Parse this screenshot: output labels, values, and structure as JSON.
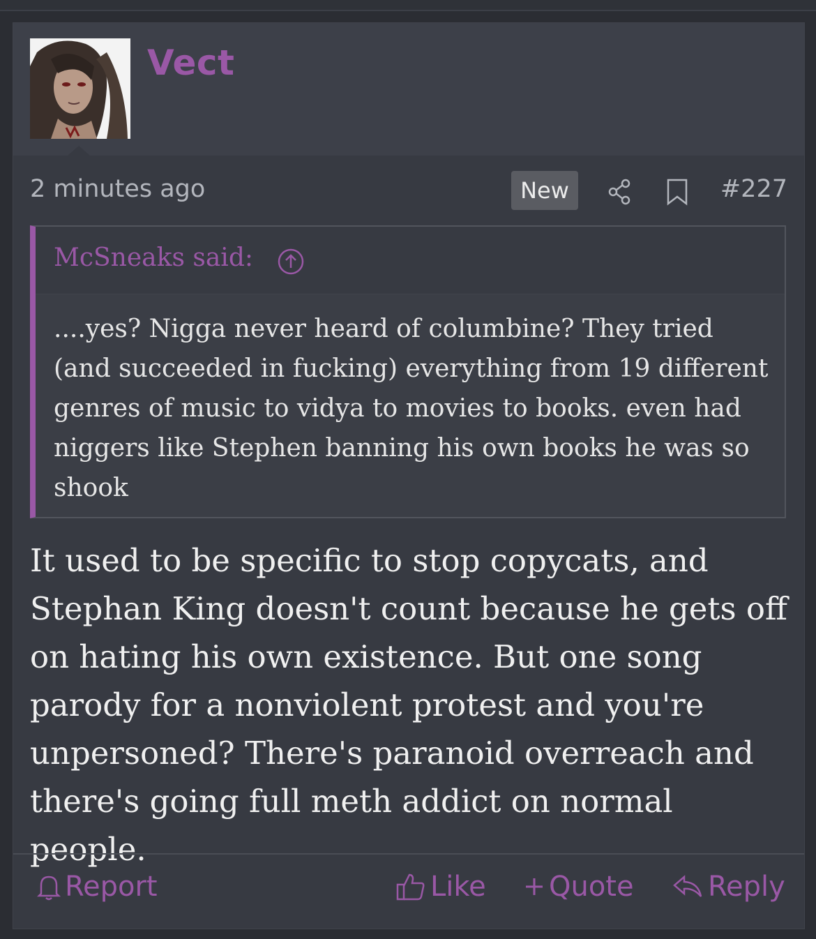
{
  "post": {
    "username": "Vect",
    "timestamp": "2 minutes ago",
    "new_badge": "New",
    "post_number": "#227",
    "quote": {
      "author": "McSneaks said:",
      "text": "....yes? Nigga never heard of columbine? They tried (and succeeded in fucking) everything from 19 different genres of music to vidya to movies to books. even had niggers like Stephen banning his own books he was so shook"
    },
    "message": "It used to be specific to stop copycats, and Stephan King doesn't count because he gets off on hating his own existence. But one song parody for a nonviolent protest and you're unpersoned? There's paranoid overreach and there's going full meth addict on normal people."
  },
  "actions": {
    "report": "Report",
    "like": "Like",
    "quote": "Quote",
    "reply": "Reply"
  },
  "icons": {
    "share": "share-icon",
    "bookmark": "bookmark-icon",
    "quote_jump": "arrow-up-circle-icon",
    "report": "bell-icon",
    "like": "thumbs-up-icon",
    "quote": "plus-icon",
    "reply": "reply-arrow-icon"
  },
  "colors": {
    "accent": "#9a58a6",
    "background": "#373a42",
    "text": "#f0f0f0"
  }
}
